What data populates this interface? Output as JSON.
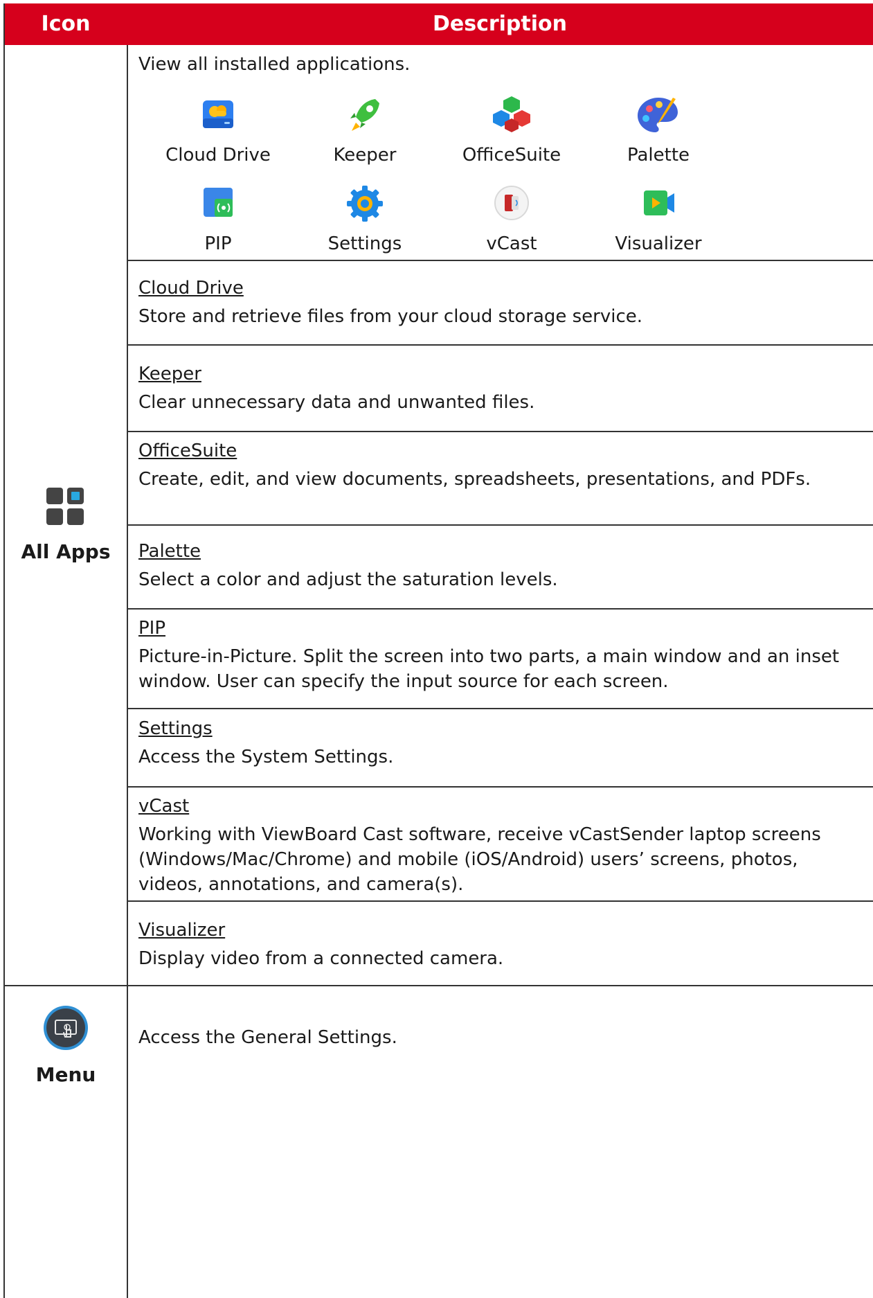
{
  "header": {
    "icon_col": "Icon",
    "desc_col": "Description"
  },
  "all_apps": {
    "label": "All Apps",
    "icon": "all-apps-grid-icon",
    "intro": "View all installed applications.",
    "apps": [
      {
        "name": "Cloud Drive",
        "icon": "cloud-drive-icon"
      },
      {
        "name": "Keeper",
        "icon": "keeper-rocket-icon"
      },
      {
        "name": "OfficeSuite",
        "icon": "officesuite-cubes-icon"
      },
      {
        "name": "Palette",
        "icon": "palette-icon"
      },
      {
        "name": "PIP",
        "icon": "pip-icon"
      },
      {
        "name": "Settings",
        "icon": "settings-gear-icon"
      },
      {
        "name": "vCast",
        "icon": "vcast-icon"
      },
      {
        "name": "Visualizer",
        "icon": "visualizer-camera-icon"
      }
    ],
    "entries": [
      {
        "title": "Cloud Drive",
        "desc": "Store and retrieve files from your cloud storage service."
      },
      {
        "title": "Keeper",
        "desc": "Clear unnecessary data and unwanted files."
      },
      {
        "title": "OfficeSuite",
        "desc": "Create, edit, and view documents, spreadsheets, presentations, and PDFs."
      },
      {
        "title": "Palette",
        "desc": "Select a color and adjust the saturation levels."
      },
      {
        "title": "PIP",
        "desc": "Picture-in-Picture. Split the screen into two parts, a main window and an inset window. User can specify the input source for each screen."
      },
      {
        "title": "Settings",
        "desc": "Access the System Settings."
      },
      {
        "title": "vCast",
        "desc": "Working with ViewBoard Cast software, receive vCastSender laptop screens (Windows/Mac/Chrome) and mobile (iOS/Android) users’ screens, photos, videos, annotations, and camera(s)."
      },
      {
        "title": "Visualizer",
        "desc": "Display video from a connected camera."
      }
    ]
  },
  "menu": {
    "label": "Menu",
    "icon": "menu-touch-icon",
    "desc": "Access the General Settings."
  },
  "colors": {
    "header_bg": "#d6001c",
    "header_text": "#ffffff",
    "border": "#333333"
  }
}
